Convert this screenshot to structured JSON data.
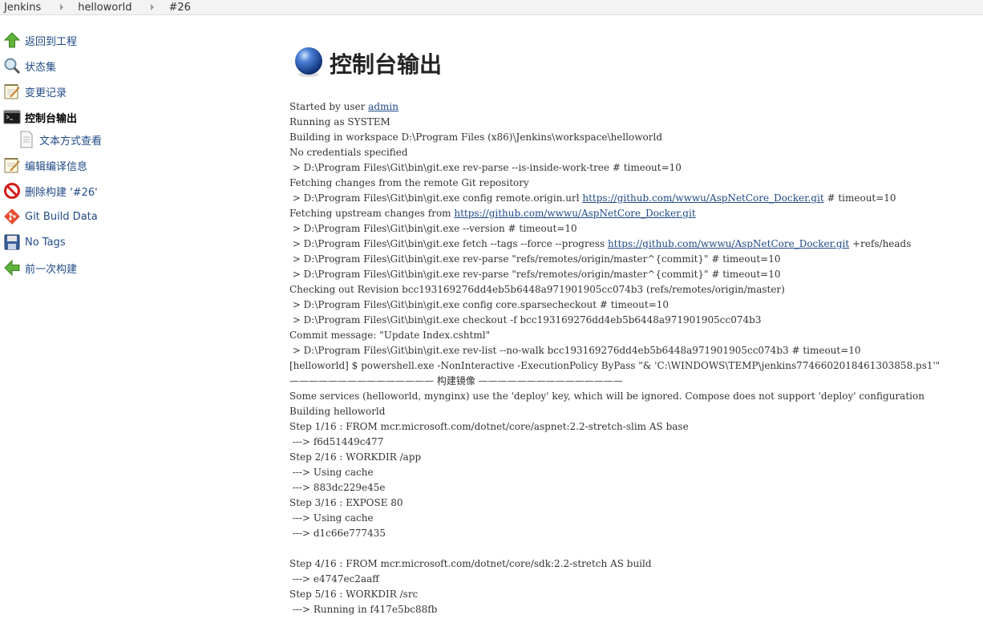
{
  "breadcrumb": [
    "Jenkins",
    "helloworld",
    "#26"
  ],
  "sidebar": {
    "items": [
      {
        "label": "返回到工程",
        "icon": "up-arrow-icon"
      },
      {
        "label": "状态集",
        "icon": "magnifier-icon"
      },
      {
        "label": "变更记录",
        "icon": "notepad-icon"
      },
      {
        "label": "控制台输出",
        "icon": "terminal-icon"
      },
      {
        "label": "文本方式查看",
        "icon": "document-icon"
      },
      {
        "label": "编辑编译信息",
        "icon": "notepad-icon"
      },
      {
        "label": "删除构建 '#26'",
        "icon": "no-entry-icon"
      },
      {
        "label": "Git Build Data",
        "icon": "git-icon"
      },
      {
        "label": "No Tags",
        "icon": "save-icon"
      },
      {
        "label": "前一次构建",
        "icon": "left-arrow-icon"
      }
    ]
  },
  "page": {
    "title": "控制台输出"
  },
  "console": {
    "lines": [
      [
        {
          "t": "Started by user "
        },
        {
          "t": "admin",
          "link": true
        }
      ],
      [
        {
          "t": "Running as SYSTEM"
        }
      ],
      [
        {
          "t": "Building in workspace D:\\Program Files (x86)\\Jenkins\\workspace\\helloworld"
        }
      ],
      [
        {
          "t": "No credentials specified"
        }
      ],
      [
        {
          "t": " > D:\\Program Files\\Git\\bin\\git.exe rev-parse --is-inside-work-tree # timeout=10"
        }
      ],
      [
        {
          "t": "Fetching changes from the remote Git repository"
        }
      ],
      [
        {
          "t": " > D:\\Program Files\\Git\\bin\\git.exe config remote.origin.url "
        },
        {
          "t": "https://github.com/wwwu/AspNetCore_Docker.git",
          "link": true
        },
        {
          "t": " # timeout=10"
        }
      ],
      [
        {
          "t": "Fetching upstream changes from "
        },
        {
          "t": "https://github.com/wwwu/AspNetCore_Docker.git",
          "link": true
        }
      ],
      [
        {
          "t": " > D:\\Program Files\\Git\\bin\\git.exe --version # timeout=10"
        }
      ],
      [
        {
          "t": " > D:\\Program Files\\Git\\bin\\git.exe fetch --tags --force --progress "
        },
        {
          "t": "https://github.com/wwwu/AspNetCore_Docker.git",
          "link": true
        },
        {
          "t": " +refs/heads"
        }
      ],
      [
        {
          "t": " > D:\\Program Files\\Git\\bin\\git.exe rev-parse \"refs/remotes/origin/master^{commit}\" # timeout=10"
        }
      ],
      [
        {
          "t": " > D:\\Program Files\\Git\\bin\\git.exe rev-parse \"refs/remotes/origin/master^{commit}\" # timeout=10"
        }
      ],
      [
        {
          "t": "Checking out Revision bcc193169276dd4eb5b6448a971901905cc074b3 (refs/remotes/origin/master)"
        }
      ],
      [
        {
          "t": " > D:\\Program Files\\Git\\bin\\git.exe config core.sparsecheckout # timeout=10"
        }
      ],
      [
        {
          "t": " > D:\\Program Files\\Git\\bin\\git.exe checkout -f bcc193169276dd4eb5b6448a971901905cc074b3"
        }
      ],
      [
        {
          "t": "Commit message: \"Update Index.cshtml\""
        }
      ],
      [
        {
          "t": " > D:\\Program Files\\Git\\bin\\git.exe rev-list --no-walk bcc193169276dd4eb5b6448a971901905cc074b3 # timeout=10"
        }
      ],
      [
        {
          "t": "[helloworld] $ powershell.exe -NonInteractive -ExecutionPolicy ByPass \"& 'C:\\WINDOWS\\TEMP\\jenkins7746602018461303858.ps1'\""
        }
      ],
      [
        {
          "t": "——————————————— 构建镜像 ———————————————"
        }
      ],
      [
        {
          "t": "Some services (helloworld, mynginx) use the 'deploy' key, which will be ignored. Compose does not support 'deploy' configuration"
        }
      ],
      [
        {
          "t": "Building helloworld"
        }
      ],
      [
        {
          "t": "Step 1/16 : FROM mcr.microsoft.com/dotnet/core/aspnet:2.2-stretch-slim AS base"
        }
      ],
      [
        {
          "t": " ---> f6d51449c477"
        }
      ],
      [
        {
          "t": "Step 2/16 : WORKDIR /app"
        }
      ],
      [
        {
          "t": " ---> Using cache"
        }
      ],
      [
        {
          "t": " ---> 883dc229e45e"
        }
      ],
      [
        {
          "t": "Step 3/16 : EXPOSE 80"
        }
      ],
      [
        {
          "t": " ---> Using cache"
        }
      ],
      [
        {
          "t": " ---> d1c66e777435"
        }
      ],
      [
        {
          "t": ""
        }
      ],
      [
        {
          "t": "Step 4/16 : FROM mcr.microsoft.com/dotnet/core/sdk:2.2-stretch AS build"
        }
      ],
      [
        {
          "t": " ---> e4747ec2aaff"
        }
      ],
      [
        {
          "t": "Step 5/16 : WORKDIR /src"
        }
      ],
      [
        {
          "t": " ---> Running in f417e5bc88fb"
        }
      ]
    ]
  }
}
